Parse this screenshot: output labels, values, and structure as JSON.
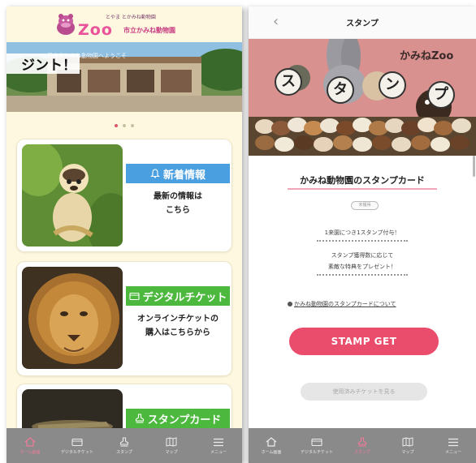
{
  "left": {
    "logo": {
      "zoo_text": "Zoo",
      "small_text": "とやま とかみね動物園",
      "sub_text": "市立かみね動物園"
    },
    "hero": {
      "caption": "日立市かみね動物園へようこそ",
      "overlay_text": "ジント！"
    },
    "carousel": {
      "dot_count": 3,
      "active_index": 0
    },
    "cards": [
      {
        "label": "新着情報",
        "icon": "bell-icon",
        "desc": [
          "最新の情報は",
          "こちら"
        ],
        "color": "#4a9fe0"
      },
      {
        "label": "デジタルチケット",
        "icon": "ticket-icon",
        "desc": [
          "オンラインチケットの",
          "購入はこちらから"
        ],
        "color": "#4cb83e"
      },
      {
        "label": "スタンプカード",
        "icon": "stamp-icon",
        "desc": [],
        "color": "#4cb83e"
      }
    ],
    "tabbar": [
      {
        "label": "ホーム画面",
        "icon": "home-icon",
        "active": true
      },
      {
        "label": "デジタルチケット",
        "icon": "ticket-icon",
        "active": false
      },
      {
        "label": "スタンプ",
        "icon": "stamp-icon",
        "active": false
      },
      {
        "label": "マップ",
        "icon": "map-icon",
        "active": false
      },
      {
        "label": "メニュー",
        "icon": "menu-icon",
        "active": false
      }
    ]
  },
  "right": {
    "header": {
      "title": "スタンプ",
      "back_icon": "chevron-left-icon"
    },
    "banner": {
      "text_top": "かみねZoo",
      "stamp_letters": [
        "ス",
        "タ",
        "ン",
        "プ"
      ]
    },
    "card_title": "かみね動物園のスタンプカード",
    "pill_text": "未獲得",
    "rules": [
      "1来園につき1スタンプ付与！",
      "スタンプ獲得数に応じて",
      "素敵な特典をプレゼント！"
    ],
    "about_link": "かみね動物園のスタンプカードについて",
    "stamp_button": "STAMP GET",
    "ticket_button": "使用済みチケットを見る",
    "tabbar": [
      {
        "label": "ホーム画面",
        "icon": "home-icon",
        "active": false
      },
      {
        "label": "デジタルチケット",
        "icon": "ticket-icon",
        "active": false
      },
      {
        "label": "スタンプ",
        "icon": "stamp-icon",
        "active": true
      },
      {
        "label": "マップ",
        "icon": "map-icon",
        "active": false
      },
      {
        "label": "メニュー",
        "icon": "menu-icon",
        "active": false
      }
    ]
  }
}
